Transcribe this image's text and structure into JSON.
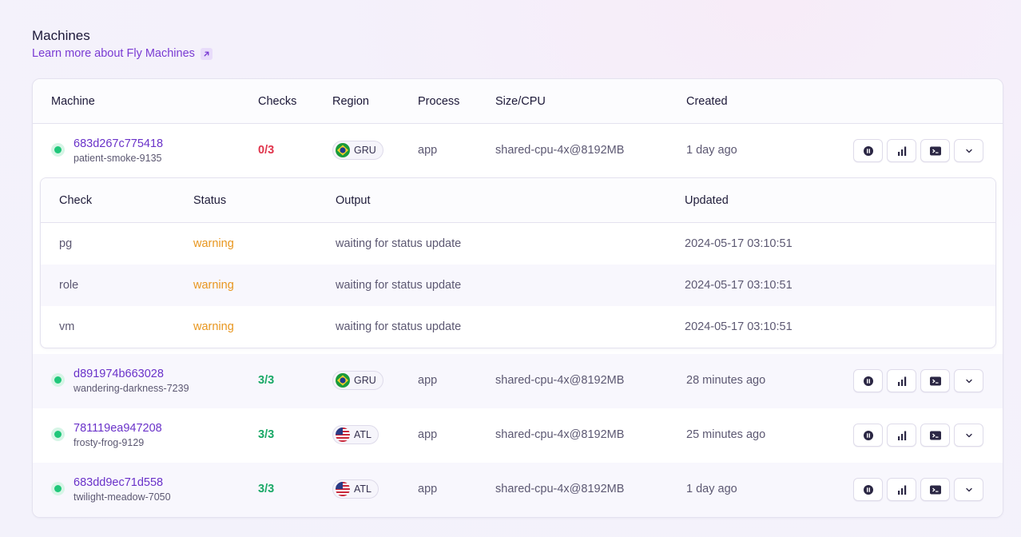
{
  "page": {
    "title": "Machines",
    "learn_more": "Learn more about Fly Machines"
  },
  "columns": {
    "machine": "Machine",
    "checks": "Checks",
    "region": "Region",
    "process": "Process",
    "size": "Size/CPU",
    "created": "Created"
  },
  "machines": [
    {
      "id": "683d267c775418",
      "name": "patient-smoke-9135",
      "checks": "0/3",
      "region": "GRU",
      "process": "app",
      "size": "shared-cpu-4x@8192MB",
      "created": "1 day ago"
    },
    {
      "id": "d891974b663028",
      "name": "wandering-darkness-7239",
      "checks": "3/3",
      "region": "GRU",
      "process": "app",
      "size": "shared-cpu-4x@8192MB",
      "created": "28 minutes ago"
    },
    {
      "id": "781119ea947208",
      "name": "frosty-frog-9129",
      "checks": "3/3",
      "region": "ATL",
      "process": "app",
      "size": "shared-cpu-4x@8192MB",
      "created": "25 minutes ago"
    },
    {
      "id": "683dd9ec71d558",
      "name": "twilight-meadow-7050",
      "checks": "3/3",
      "region": "ATL",
      "process": "app",
      "size": "shared-cpu-4x@8192MB",
      "created": "1 day ago"
    }
  ],
  "check_columns": {
    "check": "Check",
    "status": "Status",
    "output": "Output",
    "updated": "Updated"
  },
  "checks": [
    {
      "check": "pg",
      "status": "warning",
      "output": "waiting for status update",
      "updated": "2024-05-17 03:10:51"
    },
    {
      "check": "role",
      "status": "warning",
      "output": "waiting for status update",
      "updated": "2024-05-17 03:10:51"
    },
    {
      "check": "vm",
      "status": "warning",
      "output": "waiting for status update",
      "updated": "2024-05-17 03:10:51"
    }
  ],
  "colors": {
    "accent": "#7a3bd3",
    "status_ok": "#19a866",
    "status_bad": "#e0344b",
    "warning": "#e8961e",
    "running_dot": "#20c77a"
  },
  "icons": [
    "external-link-icon",
    "running-status-icon",
    "brazil-flag-icon",
    "usa-flag-icon",
    "pause-icon",
    "metrics-icon",
    "console-icon",
    "chevron-down-icon"
  ]
}
